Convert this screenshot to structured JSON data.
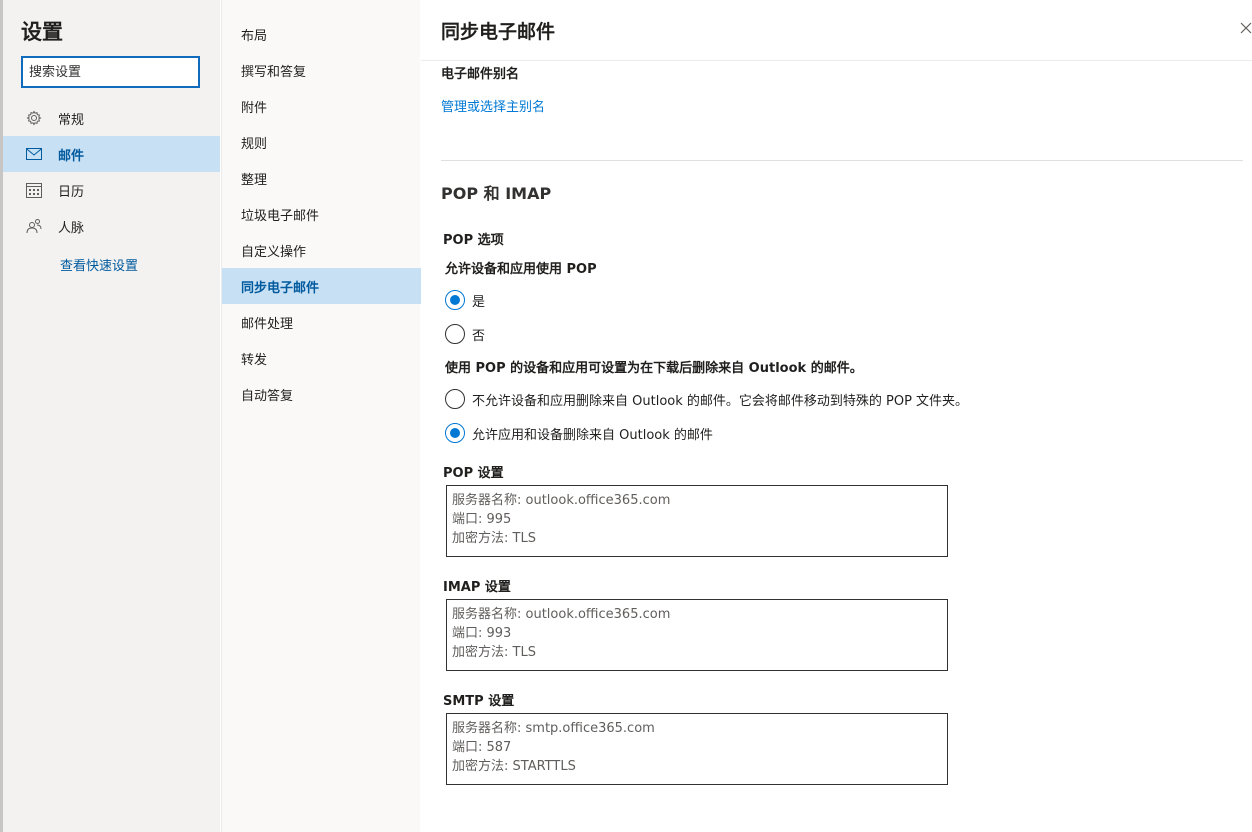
{
  "left": {
    "title": "设置",
    "search_placeholder": "搜索设置",
    "nav": [
      {
        "label": "常规",
        "icon": "gear-icon"
      },
      {
        "label": "邮件",
        "icon": "mail-icon"
      },
      {
        "label": "日历",
        "icon": "calendar-icon"
      },
      {
        "label": "人脉",
        "icon": "people-icon"
      }
    ],
    "active_nav": "邮件",
    "quick_settings": "查看快速设置"
  },
  "middle": {
    "items": [
      "布局",
      "撰写和答复",
      "附件",
      "规则",
      "整理",
      "垃圾电子邮件",
      "自定义操作",
      "同步电子邮件",
      "邮件处理",
      "转发",
      "自动答复"
    ],
    "active": "同步电子邮件"
  },
  "content": {
    "title": "同步电子邮件",
    "close_icon": "close-icon",
    "alias_label": "电子邮件别名",
    "alias_link": "管理或选择主别名",
    "section_title": "POP 和 IMAP",
    "pop_options_label": "POP 选项",
    "allow_pop_label": "允许设备和应用使用 POP",
    "allow_pop_yes": "是",
    "allow_pop_no": "否",
    "allow_pop_selected": "是",
    "delete_label": "使用 POP 的设备和应用可设置为在下载后删除来自 Outlook 的邮件。",
    "delete_option_1": "不允许设备和应用删除来自 Outlook 的邮件。它会将邮件移动到特殊的 POP 文件夹。",
    "delete_option_2": "允许应用和设备删除来自 Outlook 的邮件",
    "delete_selected": "允许应用和设备删除来自 Outlook 的邮件",
    "pop_settings": {
      "label": "POP 设置",
      "server": "服务器名称: outlook.office365.com",
      "port": "端口: 995",
      "encryption": "加密方法: TLS"
    },
    "imap_settings": {
      "label": "IMAP 设置",
      "server": "服务器名称: outlook.office365.com",
      "port": "端口: 993",
      "encryption": "加密方法: TLS"
    },
    "smtp_settings": {
      "label": "SMTP 设置",
      "server": "服务器名称: smtp.office365.com",
      "port": "端口: 587",
      "encryption": "加密方法: STARTTLS"
    }
  },
  "colors": {
    "accent": "#0078d4",
    "active_bg": "#c7e0f4",
    "link": "#005a9e"
  }
}
